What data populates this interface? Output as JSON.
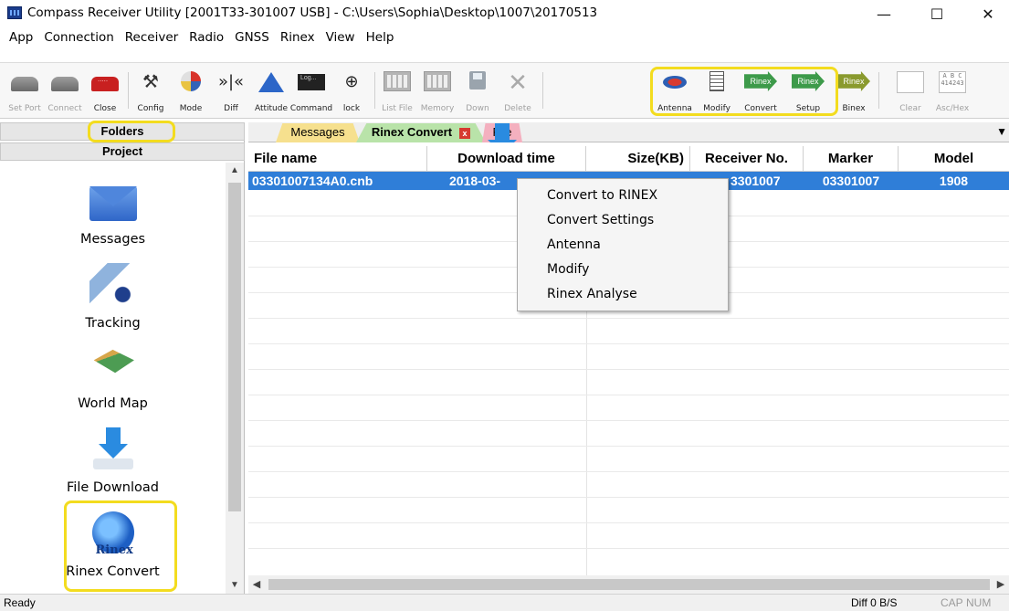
{
  "window": {
    "title": "Compass Receiver Utility [2001T33-301007 USB] - C:\\Users\\Sophia\\Desktop\\1007\\20170513",
    "controls": {
      "minimize": "—",
      "maximize": "☐",
      "close": "✕"
    }
  },
  "menu": [
    "App",
    "Connection",
    "Receiver",
    "Radio",
    "GNSS",
    "Rinex",
    "View",
    "Help"
  ],
  "toolbar": {
    "set_port": "Set Port",
    "connect": "Connect",
    "close": "Close",
    "config": "Config",
    "mode": "Mode",
    "diff": "Diff",
    "diff_glyph": "»|«",
    "attitude": "Attitude",
    "command": "Command",
    "command_text": "Log...",
    "lock": "lock",
    "list_file": "List File",
    "memory": "Memory",
    "down": "Down",
    "delete": "Delete",
    "antenna": "Antenna",
    "modify": "Modify",
    "convert": "Convert",
    "setup": "Setup",
    "binex": "Binex",
    "clear": "Clear",
    "asc_hex": "Asc/Hex",
    "rinex_icon": "Rinex",
    "ascii_icon": "A B C 414243"
  },
  "left_panel": {
    "folders_label": "Folders",
    "project_label": "Project",
    "items": [
      {
        "label": "Messages",
        "icon": "envelope-icon"
      },
      {
        "label": "Tracking",
        "icon": "satellite-icon"
      },
      {
        "label": "World Map",
        "icon": "world-map-icon"
      },
      {
        "label": "File Download",
        "icon": "download-icon"
      },
      {
        "label": "Rinex Convert",
        "icon": "rinex-icon",
        "icon_text": "Rinex"
      }
    ]
  },
  "tabs": [
    {
      "label": "Messages",
      "active": false
    },
    {
      "label": "Rinex Convert",
      "active": true,
      "close_glyph": "x"
    },
    {
      "label": "File Download",
      "active": false
    }
  ],
  "table": {
    "columns": [
      "File name",
      "Download time",
      "Size(KB)",
      "Receiver No.",
      "Marker",
      "Model"
    ],
    "rows": [
      {
        "file_name": "03301007134A0.cnb",
        "download_time": "2018-03-",
        "size": "",
        "receiver_no": "3301007",
        "marker": "03301007",
        "model": "1908",
        "selected": true
      }
    ]
  },
  "context_menu": [
    "Convert to RINEX",
    "Convert Settings",
    "Antenna",
    "Modify",
    "Rinex Analyse"
  ],
  "status_bar": {
    "left": "Ready",
    "diff": "Diff 0 B/S",
    "caps": "CAP",
    "num": "NUM"
  },
  "colors": {
    "highlight": "#f3dc1f",
    "selection": "#2f7ed8",
    "tab_messages": "#f6e08e",
    "tab_rinex": "#b9e3a9",
    "tab_download": "#f4b0bf"
  }
}
